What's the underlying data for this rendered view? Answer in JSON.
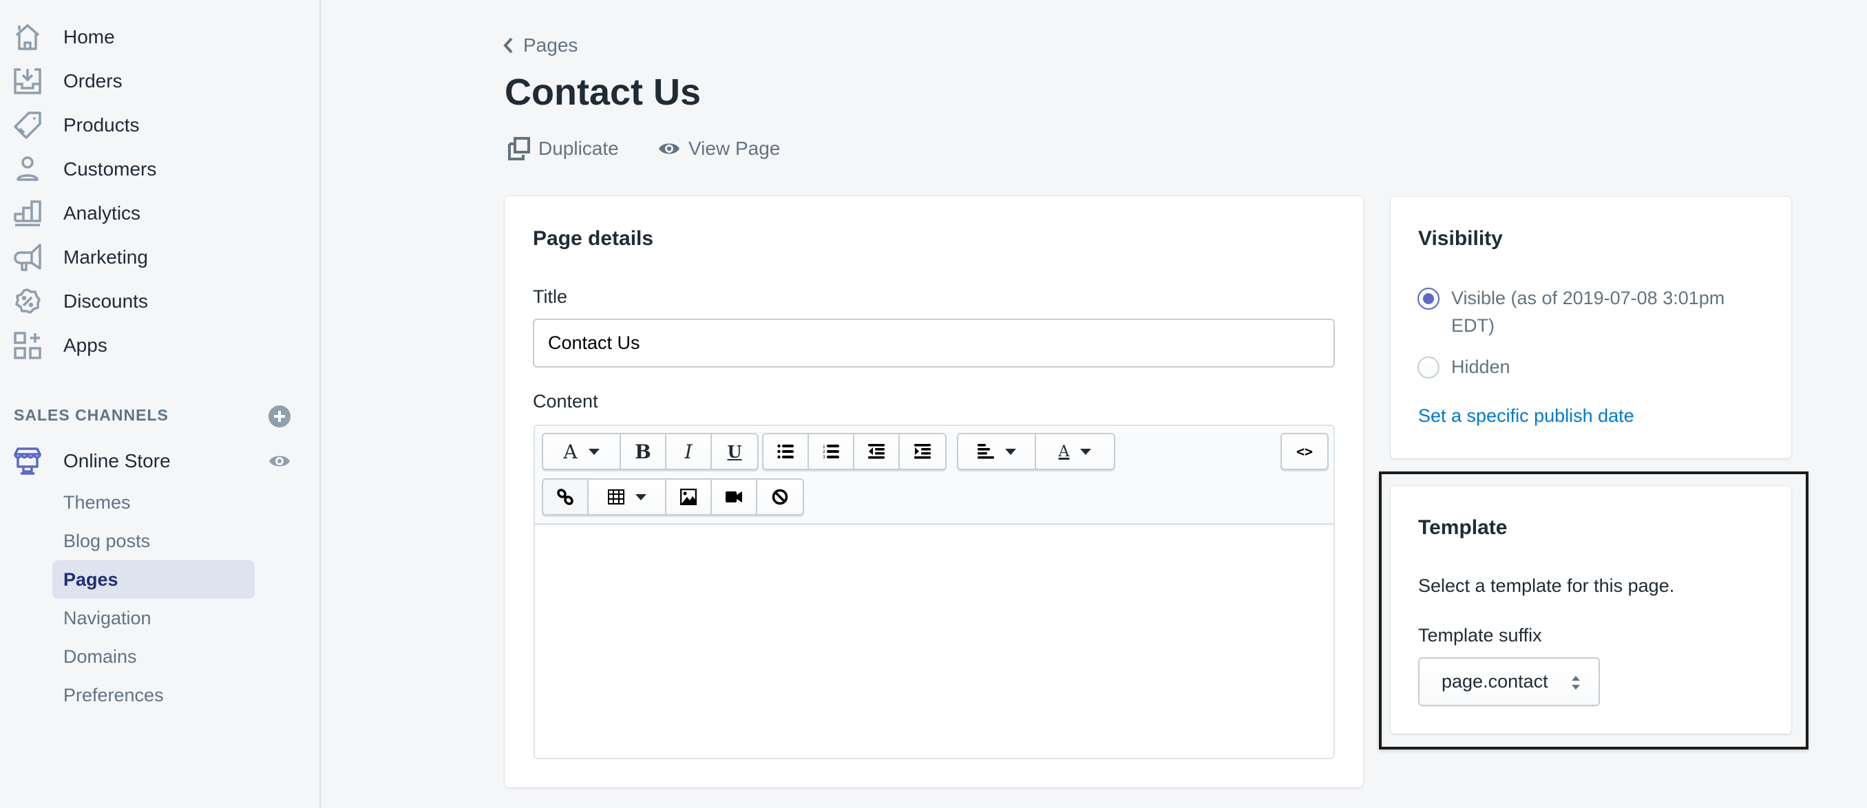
{
  "sidebar": {
    "items": [
      {
        "label": "Home",
        "icon": "home-icon"
      },
      {
        "label": "Orders",
        "icon": "orders-icon"
      },
      {
        "label": "Products",
        "icon": "tag-icon"
      },
      {
        "label": "Customers",
        "icon": "person-icon"
      },
      {
        "label": "Analytics",
        "icon": "bar-chart-icon"
      },
      {
        "label": "Marketing",
        "icon": "megaphone-icon"
      },
      {
        "label": "Discounts",
        "icon": "discount-icon"
      },
      {
        "label": "Apps",
        "icon": "apps-icon"
      }
    ],
    "sales_channels_title": "SALES CHANNELS",
    "online_store": {
      "label": "Online Store",
      "sub_items": [
        {
          "label": "Themes",
          "active": false
        },
        {
          "label": "Blog posts",
          "active": false
        },
        {
          "label": "Pages",
          "active": true
        },
        {
          "label": "Navigation",
          "active": false
        },
        {
          "label": "Domains",
          "active": false
        },
        {
          "label": "Preferences",
          "active": false
        }
      ]
    }
  },
  "header": {
    "breadcrumb": "Pages",
    "title": "Contact Us",
    "actions": {
      "duplicate": "Duplicate",
      "view_page": "View Page"
    }
  },
  "page_details": {
    "heading": "Page details",
    "title_label": "Title",
    "title_value": "Contact Us",
    "content_label": "Content",
    "content_value": "",
    "toolbar": {
      "font": "A",
      "bold": "B",
      "italic": "I",
      "underline": "U",
      "text_color": "A",
      "code": "<>"
    }
  },
  "visibility": {
    "heading": "Visibility",
    "options": [
      {
        "label": "Visible (as of 2019-07-08 3:01pm EDT)",
        "checked": true
      },
      {
        "label": "Hidden",
        "checked": false
      }
    ],
    "publish_link": "Set a specific publish date"
  },
  "template": {
    "heading": "Template",
    "description": "Select a template for this page.",
    "suffix_label": "Template suffix",
    "suffix_value": "page.contact"
  },
  "colors": {
    "accent": "#5c6ac4",
    "link": "#007ace",
    "active_nav_bg": "#dfe3ef",
    "active_nav_text": "#202e78",
    "icon_gray": "#919eab",
    "text_muted": "#637381"
  }
}
